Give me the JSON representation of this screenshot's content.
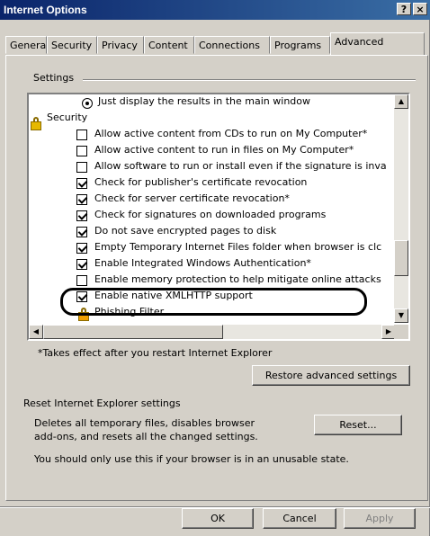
{
  "window": {
    "title": "Internet Options",
    "help_label": "?",
    "close_label": "×"
  },
  "tabs": [
    "General",
    "Security",
    "Privacy",
    "Content",
    "Connections",
    "Programs",
    "Advanced"
  ],
  "settings": {
    "legend": "Settings",
    "items": [
      {
        "type": "radio",
        "label": "Just display the results in the main window",
        "checked": true
      },
      {
        "type": "category",
        "label": "Security",
        "icon": "lock-icon"
      },
      {
        "type": "checkbox",
        "label": "Allow active content from CDs to run on My Computer*",
        "checked": false
      },
      {
        "type": "checkbox",
        "label": "Allow active content to run in files on My Computer*",
        "checked": false
      },
      {
        "type": "checkbox",
        "label": "Allow software to run or install even if the signature is inva",
        "checked": false
      },
      {
        "type": "checkbox",
        "label": "Check for publisher's certificate revocation",
        "checked": true
      },
      {
        "type": "checkbox",
        "label": "Check for server certificate revocation*",
        "checked": true
      },
      {
        "type": "checkbox",
        "label": "Check for signatures on downloaded programs",
        "checked": true
      },
      {
        "type": "checkbox",
        "label": "Do not save encrypted pages to disk",
        "checked": true
      },
      {
        "type": "checkbox",
        "label": "Empty Temporary Internet Files folder when browser is clc",
        "checked": true
      },
      {
        "type": "checkbox",
        "label": "Enable Integrated Windows Authentication*",
        "checked": true
      },
      {
        "type": "checkbox",
        "label": "Enable memory protection to help mitigate online attacks",
        "checked": false
      },
      {
        "type": "checkbox",
        "label": "Enable native XMLHTTP support",
        "checked": true
      },
      {
        "type": "category",
        "label": "Phishing Filter",
        "icon": "phishing-filter-icon"
      }
    ]
  },
  "note": "*Takes effect after you restart Internet Explorer",
  "restore_label": "Restore advanced settings",
  "reset": {
    "heading": "Reset Internet Explorer settings",
    "description_line1": "Deletes all temporary files, disables browser",
    "description_line2": "add-ons, and resets all the changed settings.",
    "button_label": "Reset...",
    "warning": "You should only use this if your browser is in an unusable state."
  },
  "footer": {
    "ok_label": "OK",
    "cancel_label": "Cancel",
    "apply_label": "Apply"
  }
}
